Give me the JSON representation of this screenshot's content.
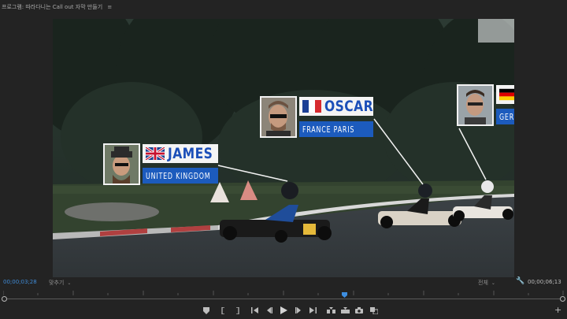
{
  "app": {
    "title": "프로그램: 따라다니는 Call out 자막 만들기",
    "menu_icon": "≡"
  },
  "viewer": {
    "callouts": [
      {
        "name": "JAMES",
        "subtitle": "UNITED KINGDOM",
        "flag": "uk-flag-icon"
      },
      {
        "name": "OSCAR",
        "subtitle": "FRANCE PARIS",
        "flag": "france-flag-icon"
      },
      {
        "name": "",
        "subtitle": "GER",
        "flag": "germany-flag-icon"
      }
    ],
    "accent_colors": {
      "name_blue": "#1c4fb8",
      "box_blue": "#1c5bbd"
    }
  },
  "bottom_bar": {
    "current_timecode": "00;00;03;28",
    "zoom_select": "맞추기",
    "quality_select": "전체",
    "duration_timecode": "00;00;06;13",
    "timecode_color": "#3f8bd6"
  },
  "controls": {
    "add_label": "+"
  }
}
